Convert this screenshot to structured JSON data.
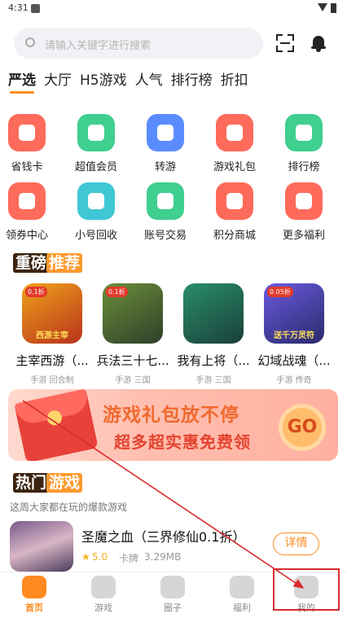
{
  "status_bar": {
    "time": "4:31"
  },
  "search": {
    "placeholder": "请输入关键字进行搜索"
  },
  "tabs": [
    {
      "label": "严选",
      "active": true
    },
    {
      "label": "大厅"
    },
    {
      "label": "H5游戏"
    },
    {
      "label": "人气"
    },
    {
      "label": "排行榜"
    },
    {
      "label": "折扣"
    }
  ],
  "quick_grid": [
    {
      "label": "省钱卡",
      "icon": "wallet-card-icon",
      "color": "#ff6b5b"
    },
    {
      "label": "超值会员",
      "icon": "vip-diamond-icon",
      "color": "#3fcf8e"
    },
    {
      "label": "转游",
      "icon": "transfer-game-icon",
      "color": "#5b8cff"
    },
    {
      "label": "游戏礼包",
      "icon": "gift-pack-icon",
      "color": "#ff6b5b"
    },
    {
      "label": "排行榜",
      "icon": "trophy-icon",
      "color": "#3fcf8e"
    },
    {
      "label": "领券中心",
      "icon": "coupon-icon",
      "color": "#ff6b5b"
    },
    {
      "label": "小号回收",
      "icon": "phone-recycle-icon",
      "color": "#3fc7d6"
    },
    {
      "label": "账号交易",
      "icon": "account-trade-icon",
      "color": "#3fcf8e"
    },
    {
      "label": "积分商城",
      "icon": "points-mall-icon",
      "color": "#ff6b5b"
    },
    {
      "label": "更多福利",
      "icon": "more-benefits-icon",
      "color": "#ff6b5b"
    }
  ],
  "recommend": {
    "title_a": "重磅",
    "title_b": "推荐",
    "games": [
      {
        "name": "主宰西游（...",
        "tag": "手游 回合制",
        "colors": [
          "#f0a21a",
          "#b8321c"
        ],
        "art_badge": "0.1折",
        "art_caption": "西游主宰"
      },
      {
        "name": "兵法三十七...",
        "tag": "手游 三国",
        "colors": [
          "#6b8f3a",
          "#2f3f2a"
        ],
        "art_badge": "0.1折",
        "art_caption": ""
      },
      {
        "name": "我有上将（...",
        "tag": "手游 三国",
        "colors": [
          "#2a8f6a",
          "#1a3f3a"
        ],
        "art_badge": "",
        "art_caption": ""
      },
      {
        "name": "幻域战魂（...",
        "tag": "手游 传奇",
        "colors": [
          "#6a5adf",
          "#2a2a6a"
        ],
        "art_badge": "0.05折",
        "art_caption": "送千万灵符"
      }
    ]
  },
  "banner": {
    "line1": "游戏礼包放不停",
    "line2": "超多超实惠免费领",
    "go": "GO"
  },
  "hot_games": {
    "title_a": "热门",
    "title_b": "游戏",
    "subtitle": "这周大家都在玩的爆款游戏",
    "item": {
      "name": "圣魔之血（三界修仙0.1折）",
      "star": "★",
      "rating": "5.0",
      "kind": "卡牌",
      "size": "3.29MB",
      "detail": "详情"
    }
  },
  "bottom_nav": [
    {
      "label": "首页",
      "icon": "home-gamepad-icon",
      "active": true
    },
    {
      "label": "游戏",
      "icon": "game-heart-icon"
    },
    {
      "label": "圈子",
      "icon": "circle-community-icon"
    },
    {
      "label": "福利",
      "icon": "gift-box-icon"
    },
    {
      "label": "我的",
      "icon": "profile-face-icon"
    }
  ],
  "colors": {
    "accent": "#ff8a1f",
    "annotation": "#d92b2b"
  }
}
